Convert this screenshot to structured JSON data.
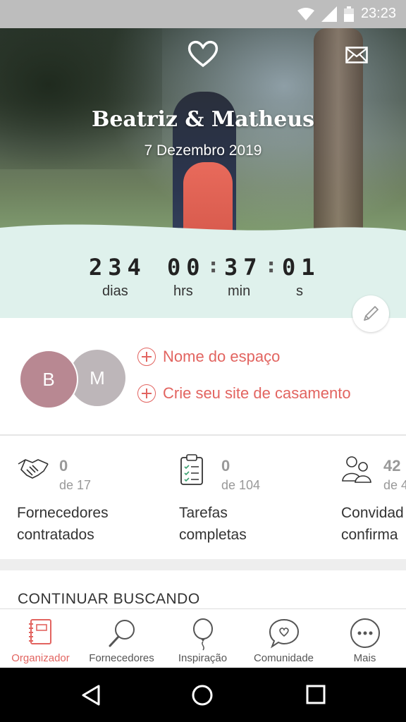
{
  "status_bar": {
    "time": "23:23"
  },
  "hero": {
    "couple_names": "Beatriz & Matheus",
    "wedding_date": "7 Dezembro 2019"
  },
  "countdown": {
    "days": "234",
    "hours": "00",
    "minutes": "37",
    "seconds": "01",
    "days_label": "dias",
    "hours_label": "hrs",
    "minutes_label": "min",
    "seconds_label": "s"
  },
  "partners": {
    "initial_1": "B",
    "initial_2": "M"
  },
  "links": {
    "venue_name": "Nome do espaço",
    "create_site": "Crie seu site de casamento"
  },
  "stats": [
    {
      "count": "0",
      "total": "de 17",
      "label_line1": "Fornecedores",
      "label_line2": "contratados",
      "icon": "handshake-icon"
    },
    {
      "count": "0",
      "total": "de 104",
      "label_line1": "Tarefas",
      "label_line2": "completas",
      "icon": "clipboard-icon"
    },
    {
      "count": "42",
      "total": "de 4",
      "label_line1": "Convidad",
      "label_line2": "confirma",
      "icon": "guests-icon"
    }
  ],
  "section": {
    "continue_searching": "CONTINUAR BUSCANDO"
  },
  "bottom_nav": [
    {
      "label": "Organizador",
      "icon": "notebook-icon",
      "active": true
    },
    {
      "label": "Fornecedores",
      "icon": "search-icon"
    },
    {
      "label": "Inspiração",
      "icon": "balloon-icon"
    },
    {
      "label": "Comunidade",
      "icon": "chat-heart-icon"
    },
    {
      "label": "Mais",
      "icon": "more-icon"
    }
  ],
  "colors": {
    "accent": "#e26460",
    "countdown_bg": "#dff1ec",
    "avatar_b": "#b88892",
    "avatar_m": "#bdb6b9"
  }
}
